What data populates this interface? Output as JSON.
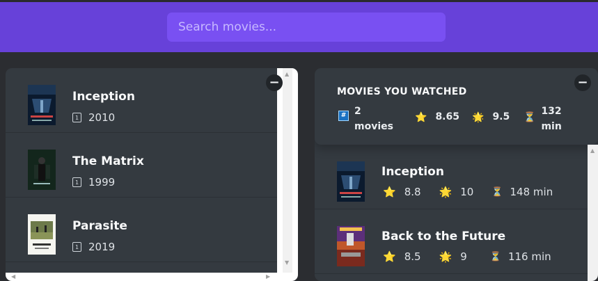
{
  "search": {
    "placeholder": "Search movies..."
  },
  "results": [
    {
      "title": "Inception",
      "year": "2010",
      "poster": "inception"
    },
    {
      "title": "The Matrix",
      "year": "1999",
      "poster": "matrix"
    },
    {
      "title": "Parasite",
      "year": "2019",
      "poster": "parasite"
    }
  ],
  "summary": {
    "heading": "MOVIES YOU WATCHED",
    "count_number": "2",
    "count_unit": "movies",
    "avg_imdb": "8.65",
    "avg_user": "9.5",
    "avg_runtime_number": "132",
    "avg_runtime_unit": "min"
  },
  "watched": [
    {
      "title": "Inception",
      "imdb": "8.8",
      "user": "10",
      "runtime": "148 min",
      "poster": "inception"
    },
    {
      "title": "Back to the Future",
      "imdb": "8.5",
      "user": "9",
      "runtime": "116 min",
      "poster": "bttf"
    }
  ],
  "icons": {
    "toggle": "−",
    "calendar": "1",
    "hash": "#",
    "star": "⭐",
    "user_star": "🌟",
    "hourglass": "⏳"
  },
  "colors": {
    "navbar": "#6741d9",
    "search": "#7950f2",
    "box": "#343a40",
    "background": "#2b2d31"
  }
}
